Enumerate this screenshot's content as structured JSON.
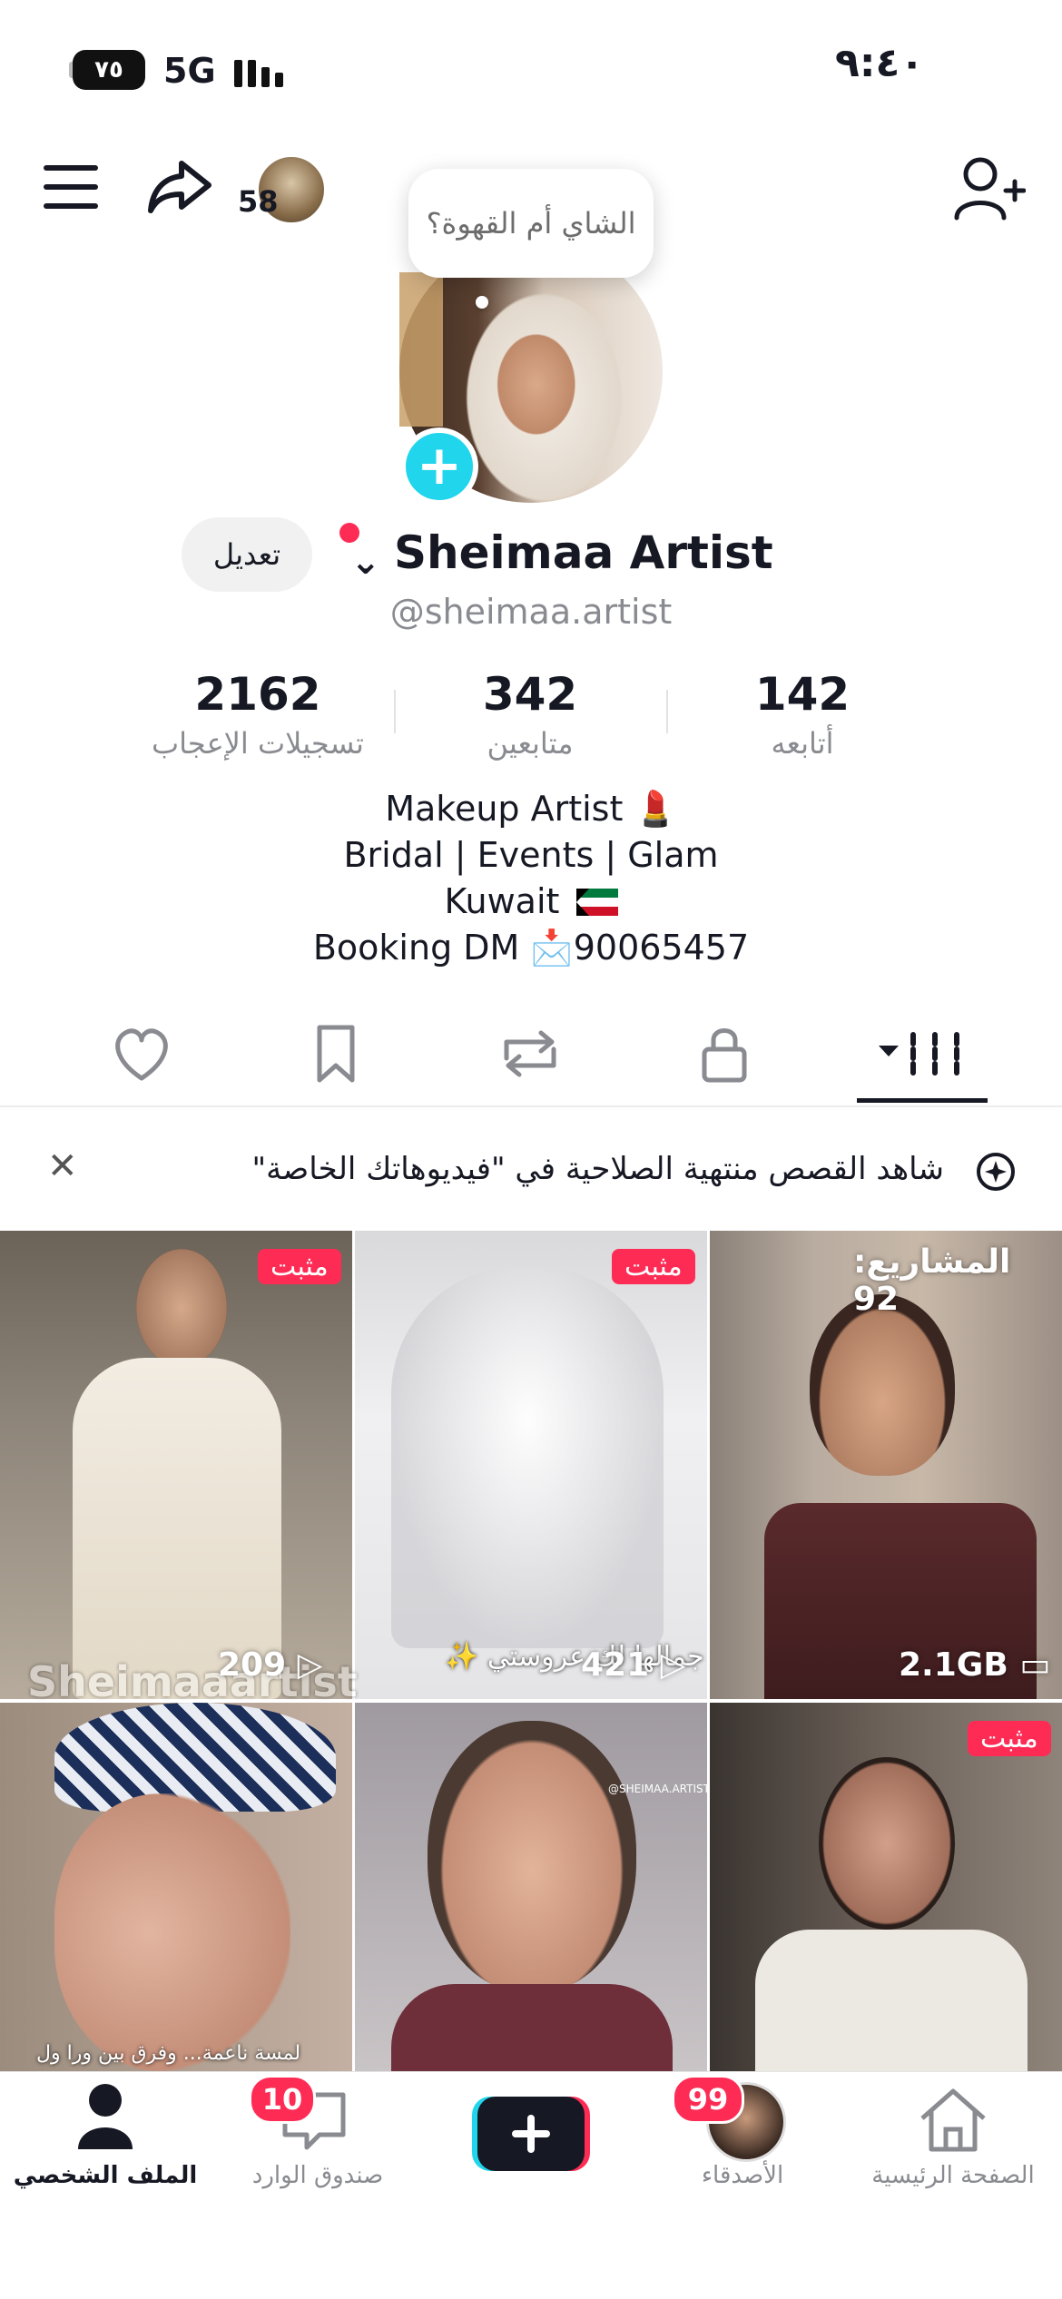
{
  "status_bar": {
    "time": "٩:٤٠",
    "battery": "٧٥",
    "network": "5G"
  },
  "top_bar": {
    "follow_badge": "58"
  },
  "profile": {
    "note_bubble": "الشاي أم القهوة؟",
    "display_name": "Sheimaa Artist",
    "username": "@sheimaa.artist",
    "edit_label": "تعديل",
    "stats": [
      {
        "value": "2162",
        "label": "تسجيلات الإعجاب"
      },
      {
        "value": "342",
        "label": "متابعين"
      },
      {
        "value": "142",
        "label": "أتابعه"
      }
    ],
    "bio": {
      "line1": "Makeup Artist 💄",
      "line2": "Bridal | Events | Glam",
      "line3": "Kuwait",
      "line4": "Booking DM 📩90065457"
    }
  },
  "notice": {
    "text": "شاهد القصص منتهية الصلاحية في \"فيديوهاتك الخاصة\""
  },
  "grid": {
    "pinned_label": "مثبت",
    "drafts_label": "المشاريع: 92",
    "tiles": [
      {
        "views": "2.1GB",
        "overlay": ""
      },
      {
        "views": "421",
        "overlay": "جمالها لك عروستي ✨"
      },
      {
        "views": "209",
        "overlay": "Sheimaaartist"
      },
      {
        "views": "",
        "overlay": ""
      },
      {
        "views": "",
        "overlay": "@SHEIMAA.ARTIST"
      },
      {
        "views": "",
        "overlay": "لمسة ناعمة... وفرق بين ورا ول"
      }
    ]
  },
  "bottom_nav": {
    "home": "الصفحة الرئيسية",
    "friends": "الأصدقاء",
    "friends_badge": "99",
    "inbox": "صندوق الوارد",
    "inbox_badge": "10",
    "profile": "الملف الشخصي"
  },
  "colors": {
    "accent": "#fe2c55",
    "cyan": "#20d5ec",
    "text": "#161823",
    "muted": "#8a8b91"
  }
}
